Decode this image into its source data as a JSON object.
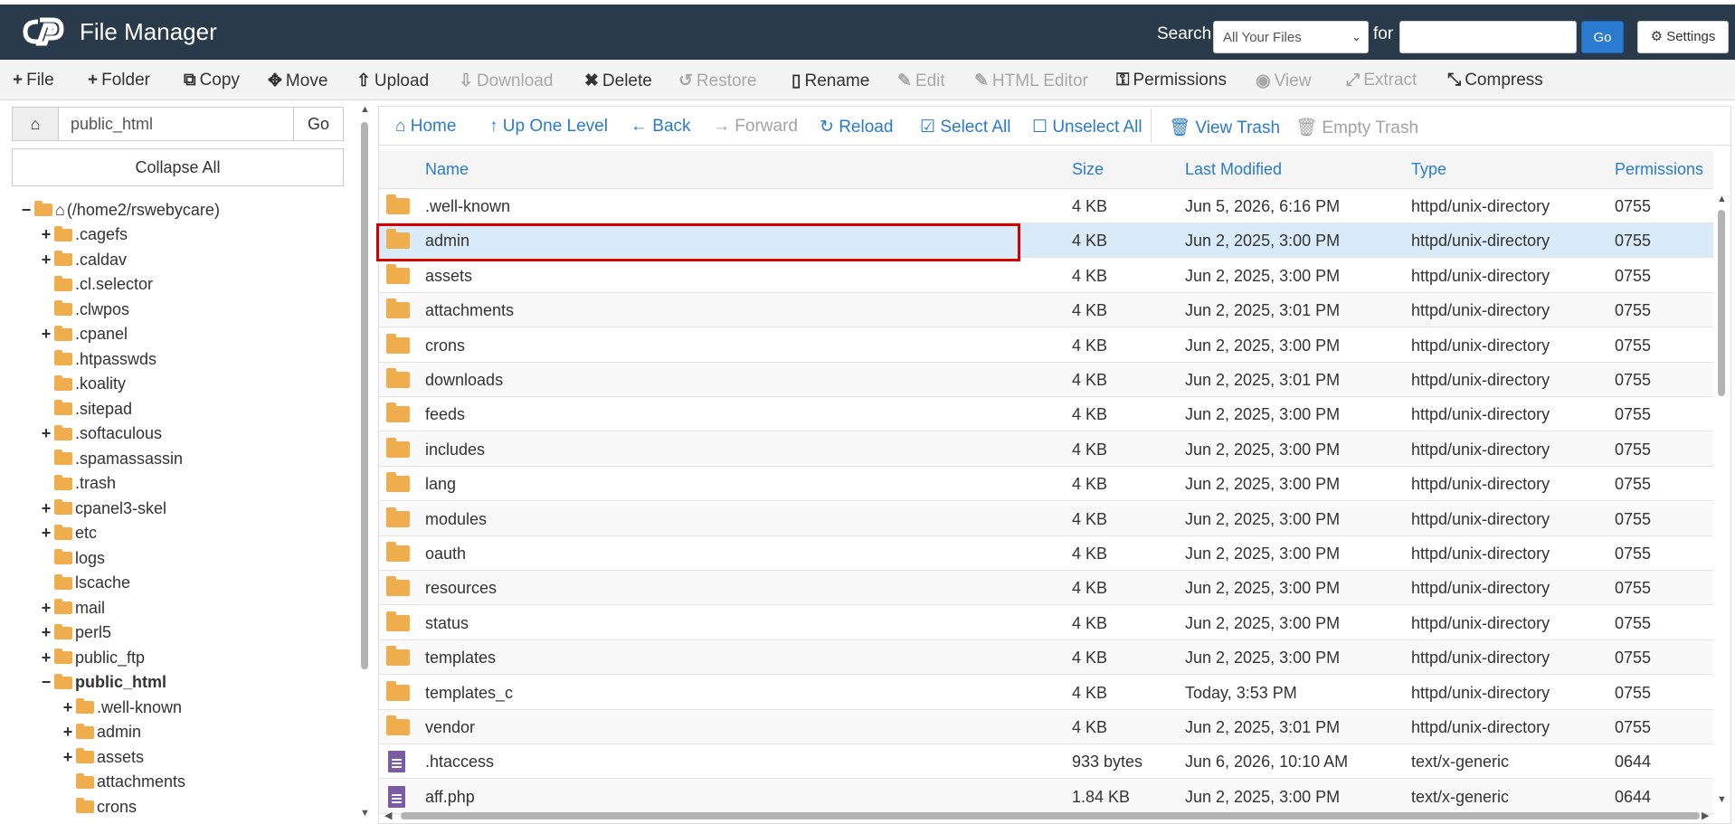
{
  "header": {
    "title": "File Manager",
    "search_label": "Search",
    "search_scope": "All Your Files",
    "for_label": "for",
    "search_value": "",
    "go_label": "Go",
    "settings_label": "Settings"
  },
  "toolbar": [
    {
      "label": "File",
      "icon": "+",
      "enabled": true
    },
    {
      "label": "Folder",
      "icon": "+",
      "enabled": true
    },
    {
      "label": "Copy",
      "icon": "⧉",
      "enabled": true
    },
    {
      "label": "Move",
      "icon": "✥",
      "enabled": true
    },
    {
      "label": "Upload",
      "icon": "⇧",
      "enabled": true
    },
    {
      "label": "Download",
      "icon": "⇩",
      "enabled": false
    },
    {
      "label": "Delete",
      "icon": "✖",
      "enabled": true
    },
    {
      "label": "Restore",
      "icon": "↺",
      "enabled": false
    },
    {
      "label": "Rename",
      "icon": "▯",
      "enabled": true
    },
    {
      "label": "Edit",
      "icon": "✎",
      "enabled": false
    },
    {
      "label": "HTML Editor",
      "icon": "✎",
      "enabled": false
    },
    {
      "label": "Permissions",
      "icon": "⚿",
      "enabled": true
    },
    {
      "label": "View",
      "icon": "◉",
      "enabled": false
    },
    {
      "label": "Extract",
      "icon": "⤢",
      "enabled": false
    },
    {
      "label": "Compress",
      "icon": "⤡",
      "enabled": true
    }
  ],
  "sidebar": {
    "path_value": "public_html",
    "go_label": "Go",
    "collapse_label": "Collapse All",
    "tree": [
      {
        "label": "(/home2/rswebycare)",
        "toggle": "−",
        "home": true
      },
      {
        "label": ".cagefs",
        "toggle": "+"
      },
      {
        "label": ".caldav",
        "toggle": "+"
      },
      {
        "label": ".cl.selector",
        "toggle": ""
      },
      {
        "label": ".clwpos",
        "toggle": ""
      },
      {
        "label": ".cpanel",
        "toggle": "+"
      },
      {
        "label": ".htpasswds",
        "toggle": ""
      },
      {
        "label": ".koality",
        "toggle": ""
      },
      {
        "label": ".sitepad",
        "toggle": ""
      },
      {
        "label": ".softaculous",
        "toggle": "+"
      },
      {
        "label": ".spamassassin",
        "toggle": ""
      },
      {
        "label": ".trash",
        "toggle": ""
      },
      {
        "label": "cpanel3-skel",
        "toggle": "+"
      },
      {
        "label": "etc",
        "toggle": "+"
      },
      {
        "label": "logs",
        "toggle": ""
      },
      {
        "label": "lscache",
        "toggle": ""
      },
      {
        "label": "mail",
        "toggle": "+"
      },
      {
        "label": "perl5",
        "toggle": "+"
      },
      {
        "label": "public_ftp",
        "toggle": "+"
      },
      {
        "label": "public_html",
        "toggle": "−",
        "bold": true
      },
      {
        "label": ".well-known",
        "toggle": "+",
        "child": true
      },
      {
        "label": "admin",
        "toggle": "+",
        "child": true
      },
      {
        "label": "assets",
        "toggle": "+",
        "child": true
      },
      {
        "label": "attachments",
        "toggle": "",
        "child": true
      },
      {
        "label": "crons",
        "toggle": "",
        "child": true
      }
    ]
  },
  "nav": [
    {
      "label": "Home",
      "icon": "⌂",
      "enabled": true
    },
    {
      "label": "Up One Level",
      "icon": "↑",
      "enabled": true
    },
    {
      "label": "Back",
      "icon": "←",
      "enabled": true
    },
    {
      "label": "Forward",
      "icon": "→",
      "enabled": false
    },
    {
      "label": "Reload",
      "icon": "↻",
      "enabled": true
    },
    {
      "label": "Select All",
      "icon": "☑",
      "enabled": true
    },
    {
      "label": "Unselect All",
      "icon": "☐",
      "enabled": true
    },
    {
      "label": "View Trash",
      "icon": "🗑",
      "enabled": true
    },
    {
      "label": "Empty Trash",
      "icon": "🗑",
      "enabled": false
    }
  ],
  "columns": {
    "name": "Name",
    "size": "Size",
    "modified": "Last Modified",
    "type": "Type",
    "perms": "Permissions"
  },
  "files": [
    {
      "name": ".well-known",
      "size": "4 KB",
      "modified": "Jun 5, 2026, 6:16 PM",
      "type": "httpd/unix-directory",
      "perms": "0755",
      "kind": "folder"
    },
    {
      "name": "admin",
      "size": "4 KB",
      "modified": "Jun 2, 2025, 3:00 PM",
      "type": "httpd/unix-directory",
      "perms": "0755",
      "kind": "folder",
      "selected": true
    },
    {
      "name": "assets",
      "size": "4 KB",
      "modified": "Jun 2, 2025, 3:00 PM",
      "type": "httpd/unix-directory",
      "perms": "0755",
      "kind": "folder"
    },
    {
      "name": "attachments",
      "size": "4 KB",
      "modified": "Jun 2, 2025, 3:01 PM",
      "type": "httpd/unix-directory",
      "perms": "0755",
      "kind": "folder"
    },
    {
      "name": "crons",
      "size": "4 KB",
      "modified": "Jun 2, 2025, 3:00 PM",
      "type": "httpd/unix-directory",
      "perms": "0755",
      "kind": "folder"
    },
    {
      "name": "downloads",
      "size": "4 KB",
      "modified": "Jun 2, 2025, 3:01 PM",
      "type": "httpd/unix-directory",
      "perms": "0755",
      "kind": "folder"
    },
    {
      "name": "feeds",
      "size": "4 KB",
      "modified": "Jun 2, 2025, 3:00 PM",
      "type": "httpd/unix-directory",
      "perms": "0755",
      "kind": "folder"
    },
    {
      "name": "includes",
      "size": "4 KB",
      "modified": "Jun 2, 2025, 3:00 PM",
      "type": "httpd/unix-directory",
      "perms": "0755",
      "kind": "folder"
    },
    {
      "name": "lang",
      "size": "4 KB",
      "modified": "Jun 2, 2025, 3:00 PM",
      "type": "httpd/unix-directory",
      "perms": "0755",
      "kind": "folder"
    },
    {
      "name": "modules",
      "size": "4 KB",
      "modified": "Jun 2, 2025, 3:00 PM",
      "type": "httpd/unix-directory",
      "perms": "0755",
      "kind": "folder"
    },
    {
      "name": "oauth",
      "size": "4 KB",
      "modified": "Jun 2, 2025, 3:00 PM",
      "type": "httpd/unix-directory",
      "perms": "0755",
      "kind": "folder"
    },
    {
      "name": "resources",
      "size": "4 KB",
      "modified": "Jun 2, 2025, 3:00 PM",
      "type": "httpd/unix-directory",
      "perms": "0755",
      "kind": "folder"
    },
    {
      "name": "status",
      "size": "4 KB",
      "modified": "Jun 2, 2025, 3:00 PM",
      "type": "httpd/unix-directory",
      "perms": "0755",
      "kind": "folder"
    },
    {
      "name": "templates",
      "size": "4 KB",
      "modified": "Jun 2, 2025, 3:00 PM",
      "type": "httpd/unix-directory",
      "perms": "0755",
      "kind": "folder"
    },
    {
      "name": "templates_c",
      "size": "4 KB",
      "modified": "Today, 3:53 PM",
      "type": "httpd/unix-directory",
      "perms": "0755",
      "kind": "folder"
    },
    {
      "name": "vendor",
      "size": "4 KB",
      "modified": "Jun 2, 2025, 3:01 PM",
      "type": "httpd/unix-directory",
      "perms": "0755",
      "kind": "folder"
    },
    {
      "name": ".htaccess",
      "size": "933 bytes",
      "modified": "Jun 6, 2026, 10:10 AM",
      "type": "text/x-generic",
      "perms": "0644",
      "kind": "file"
    },
    {
      "name": "aff.php",
      "size": "1.84 KB",
      "modified": "Jun 2, 2025, 3:00 PM",
      "type": "text/x-generic",
      "perms": "0644",
      "kind": "file"
    }
  ],
  "colors": {
    "header_bg": "#293a4a",
    "link": "#2a7bd0",
    "folder": "#f0ad4e",
    "selected_row": "#d9ebf8",
    "highlight_border": "#d40000"
  }
}
